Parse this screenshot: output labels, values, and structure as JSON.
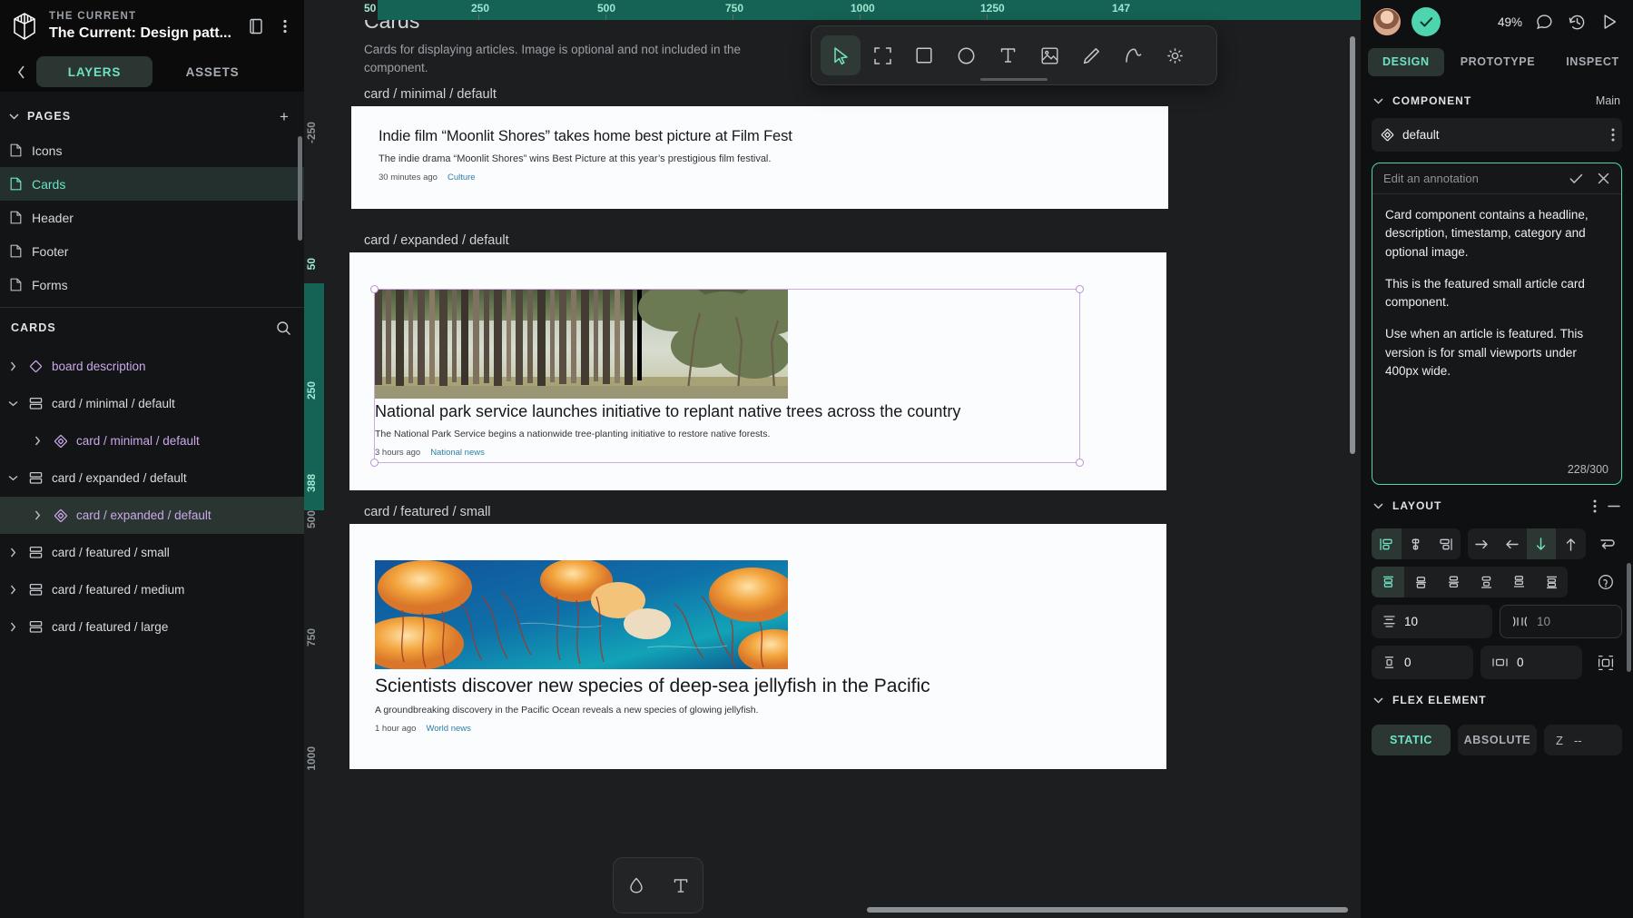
{
  "left_panel": {
    "eyebrow": "THE CURRENT",
    "file_title": "The Current: Design patt...",
    "tabs": [
      {
        "label": "LAYERS",
        "active": true
      },
      {
        "label": "ASSETS",
        "active": false
      }
    ],
    "pages_section": {
      "label": "PAGES",
      "add_label": "+"
    },
    "pages": [
      {
        "label": "Icons",
        "active": false
      },
      {
        "label": "Cards",
        "active": true
      },
      {
        "label": "Header",
        "active": false
      },
      {
        "label": "Footer",
        "active": false
      },
      {
        "label": "Forms",
        "active": false
      }
    ],
    "layers_section": {
      "label": "CARDS"
    },
    "layers": [
      {
        "label": "board description",
        "type": "component",
        "indent": 0,
        "expanded": false,
        "selected": false
      },
      {
        "label": "card / minimal / default",
        "type": "frame",
        "indent": 0,
        "expanded": true,
        "selected": false
      },
      {
        "label": "card / minimal / default",
        "type": "instance",
        "indent": 1,
        "expanded": false,
        "selected": false
      },
      {
        "label": "card / expanded / default",
        "type": "frame",
        "indent": 0,
        "expanded": true,
        "selected": false
      },
      {
        "label": "card / expanded / default",
        "type": "instance",
        "indent": 1,
        "expanded": false,
        "selected": true
      },
      {
        "label": "card / featured / small",
        "type": "frame",
        "indent": 0,
        "expanded": false,
        "selected": false
      },
      {
        "label": "card / featured / medium",
        "type": "frame",
        "indent": 0,
        "expanded": false,
        "selected": false
      },
      {
        "label": "card / featured / large",
        "type": "frame",
        "indent": 0,
        "expanded": false,
        "selected": false
      }
    ]
  },
  "canvas": {
    "ruler_top_ticks": [
      "50",
      "250",
      "500",
      "750",
      "1000",
      "1250",
      "147"
    ],
    "ruler_left_ticks": [
      "-250",
      "50",
      "250",
      "388",
      "500",
      "750",
      "1000"
    ],
    "board_title": "Cards",
    "board_subtitle": "Cards for displaying articles. Image is optional and not included in the component.",
    "toolbar": [
      {
        "name": "move-tool",
        "active": true
      },
      {
        "name": "frame-tool",
        "active": false
      },
      {
        "name": "rectangle-tool",
        "active": false
      },
      {
        "name": "ellipse-tool",
        "active": false
      },
      {
        "name": "text-tool",
        "active": false
      },
      {
        "name": "image-tool",
        "active": false
      },
      {
        "name": "pen-tool",
        "active": false
      },
      {
        "name": "path-tool",
        "active": false
      },
      {
        "name": "plugins-tool",
        "active": false
      }
    ],
    "mini_toolbar": [
      {
        "name": "shape-tool"
      },
      {
        "name": "text-tool"
      }
    ],
    "cards": [
      {
        "label": "card / minimal / default",
        "headline": "Indie film “Moonlit Shores” takes home best picture at Film Fest",
        "description": "The indie drama “Moonlit Shores” wins Best Picture at this year’s prestigious film festival.",
        "time": "30 minutes ago",
        "category": "Culture"
      },
      {
        "label": "card / expanded / default",
        "headline": "National park service launches initiative to replant native trees across the country",
        "description": "The National Park Service begins a nationwide tree-planting initiative to restore native forests.",
        "time": "3 hours ago",
        "category": "National news"
      },
      {
        "label": "card / featured / small",
        "headline": "Scientists discover new species of deep-sea jellyfish in the Pacific",
        "description": "A groundbreaking discovery in the Pacific Ocean reveals a new species of glowing jellyfish.",
        "time": "1 hour ago",
        "category": "World news"
      }
    ]
  },
  "right_panel": {
    "zoom": "49%",
    "tabs": [
      {
        "label": "DESIGN",
        "active": true
      },
      {
        "label": "PROTOTYPE",
        "active": false
      },
      {
        "label": "INSPECT",
        "active": false
      }
    ],
    "component_section": {
      "label": "COMPONENT",
      "main_label": "Main",
      "name": "default"
    },
    "annotation": {
      "header": "Edit an annotation",
      "paragraphs": [
        "Card component contains a headline, description, timestamp, category and optional image.",
        "This is the featured small article card component.",
        "Use when an article is featured. This version is for small viewports under 400px wide."
      ],
      "counter": "228/300"
    },
    "layout_section": {
      "label": "LAYOUT",
      "align_buttons": [
        {
          "name": "align-left",
          "active": true
        },
        {
          "name": "align-center",
          "active": false
        },
        {
          "name": "align-right",
          "active": false
        }
      ],
      "direction_buttons": [
        {
          "name": "direction-right",
          "active": false
        },
        {
          "name": "direction-left",
          "active": false
        },
        {
          "name": "direction-down",
          "active": true
        },
        {
          "name": "direction-up",
          "active": false
        },
        {
          "name": "direction-wrap",
          "active": false
        }
      ],
      "distribute_buttons": [
        {
          "name": "distribute-top",
          "active": true
        },
        {
          "name": "distribute-middle",
          "active": false
        },
        {
          "name": "distribute-bottom",
          "active": false
        },
        {
          "name": "distribute-space-between",
          "active": false
        },
        {
          "name": "distribute-packed-bottom",
          "active": false
        },
        {
          "name": "distribute-baseline",
          "active": false
        }
      ],
      "fields": {
        "vertical_gap": "10",
        "horizontal_gap": "10",
        "vertical_padding": "0",
        "horizontal_padding": "0"
      }
    },
    "flex_element_section": {
      "label": "FLEX ELEMENT",
      "position_options": [
        {
          "label": "STATIC",
          "active": true
        },
        {
          "label": "ABSOLUTE",
          "active": false
        }
      ],
      "z_label": "Z",
      "z_value": "--"
    }
  },
  "colors": {
    "accent": "#6ee3c4",
    "ruler_highlight": "#156354",
    "selection": "#d0a8e0",
    "component_purple": "#c9a9e8"
  }
}
